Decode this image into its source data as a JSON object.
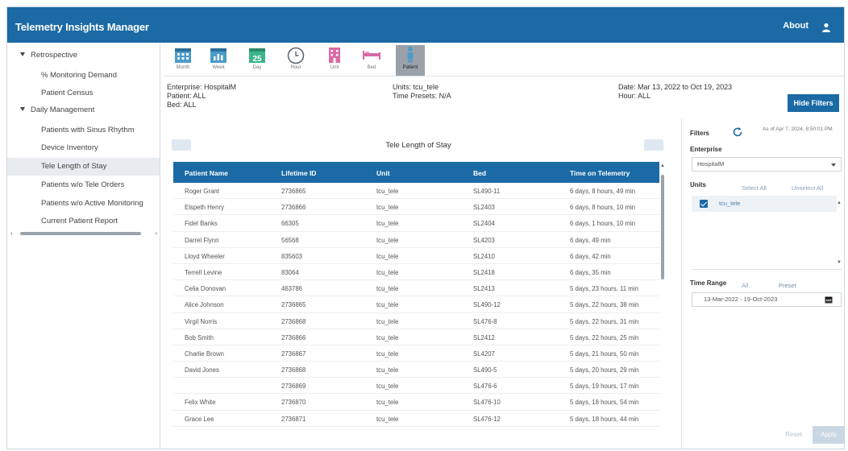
{
  "app": {
    "title": "Telemetry Insights Manager",
    "about": "About"
  },
  "sidebar": {
    "groups": [
      {
        "label": "Retrospective"
      },
      {
        "label": "Daily Management"
      }
    ],
    "items": [
      {
        "label": "% Monitoring Demand"
      },
      {
        "label": "Patient Census"
      },
      {
        "label": "Patients with Sinus Rhythm"
      },
      {
        "label": "Device Inventory"
      },
      {
        "label": "Tele Length of Stay"
      },
      {
        "label": "Patients w/o Tele Orders"
      },
      {
        "label": "Patients w/o Active Monitoring"
      },
      {
        "label": "Current Patient Report"
      }
    ],
    "active_item": "Tele Length of Stay"
  },
  "toolbar": {
    "tools": [
      {
        "label": "Month",
        "icon": "calendar-month-icon"
      },
      {
        "label": "Week",
        "icon": "calendar-week-icon"
      },
      {
        "label": "Day",
        "icon": "calendar-day-icon",
        "number": "25"
      },
      {
        "label": "Hour",
        "icon": "clock-icon"
      },
      {
        "label": "Unit",
        "icon": "building-icon"
      },
      {
        "label": "Bed",
        "icon": "bed-icon"
      },
      {
        "label": "Patient",
        "icon": "person-icon"
      }
    ],
    "active_tool": "Patient"
  },
  "summary": {
    "enterprise": "Enterprise: HospitalM",
    "patient": "Patient: ALL",
    "bed": "Bed: ALL",
    "units": "Units: tcu_tele",
    "time_presets": "Time Presets: N/A",
    "date": "Date: Mar 13, 2022 to Oct 19, 2023",
    "hour": "Hour: ALL"
  },
  "hide_filters": "Hide Filters",
  "report": {
    "title": "Tele Length of Stay",
    "columns": [
      "Patient Name",
      "Lifetime ID",
      "Unit",
      "Bed",
      "Time on Telemetry"
    ],
    "rows": [
      [
        "Roger Grant",
        "2736865",
        "tcu_tele",
        "SL490-11",
        "6 days, 8 hours, 49 min"
      ],
      [
        "Elspeth Henry",
        "2736866",
        "tcu_tele",
        "SL2403",
        "6 days, 8 hours, 10 min"
      ],
      [
        "Fidel Banks",
        "66305",
        "tcu_tele",
        "SL2404",
        "6 days, 1 hours, 10 min"
      ],
      [
        "Darrel Flynn",
        "56568",
        "tcu_tele",
        "SL4203",
        "6 days, 49 min"
      ],
      [
        "Lloyd Wheeler",
        "835603",
        "tcu_tele",
        "SL2410",
        "6 days, 42 min"
      ],
      [
        "Terrell Levine",
        "83064",
        "tcu_tele",
        "SL2418",
        "6 days, 35 min"
      ],
      [
        "Celia Donovan",
        "463786",
        "tcu_tele",
        "SL2413",
        "5 days, 23 hours, 11 min"
      ],
      [
        "Alice Johnson",
        "2736865",
        "tcu_tele",
        "SL490-12",
        "5 days, 22 hours, 38 min"
      ],
      [
        "Virgil Norris",
        "2736868",
        "tcu_tele",
        "SL476-8",
        "5 days, 22 hours, 31 min"
      ],
      [
        "Bob Smith",
        "2736866",
        "tcu_tele",
        "SL2412",
        "5 days, 22 hours, 25 min"
      ],
      [
        "Charlie Brown",
        "2736867",
        "tcu_tele",
        "SL4207",
        "5 days, 21 hours, 50 min"
      ],
      [
        "David Jones",
        "2736868",
        "tcu_tele",
        "SL490-5",
        "5 days, 20 hours, 29 min"
      ],
      [
        "",
        "2736869",
        "tcu_tele",
        "SL476-6",
        "5 days, 19 hours, 17 min"
      ],
      [
        "Felix White",
        "2736870",
        "tcu_tele",
        "SL476-10",
        "5 days, 18 hours, 54 min"
      ],
      [
        "Grace Lee",
        "2736871",
        "tcu_tele",
        "SL476-12",
        "5 days, 18 hours, 44 min"
      ]
    ]
  },
  "filters": {
    "title": "Filters",
    "as_of": "As of Apr 7, 2024, 8:50:01 PM",
    "enterprise_label": "Enterprise",
    "enterprise_value": "HospitalM",
    "units_label": "Units",
    "select_all": "Select All",
    "unselect_all": "Unselect All",
    "units": [
      {
        "label": "tcu_tele",
        "checked": true
      }
    ],
    "time_range_label": "Time Range",
    "all": "All",
    "preset": "Preset",
    "time_range_value": "13-Mar-2022 - 19-Oct-2023",
    "reset": "Reset",
    "apply": "Apply"
  },
  "colors": {
    "brand": "#1b6aa5",
    "active_tool": "#9aa1a8"
  }
}
